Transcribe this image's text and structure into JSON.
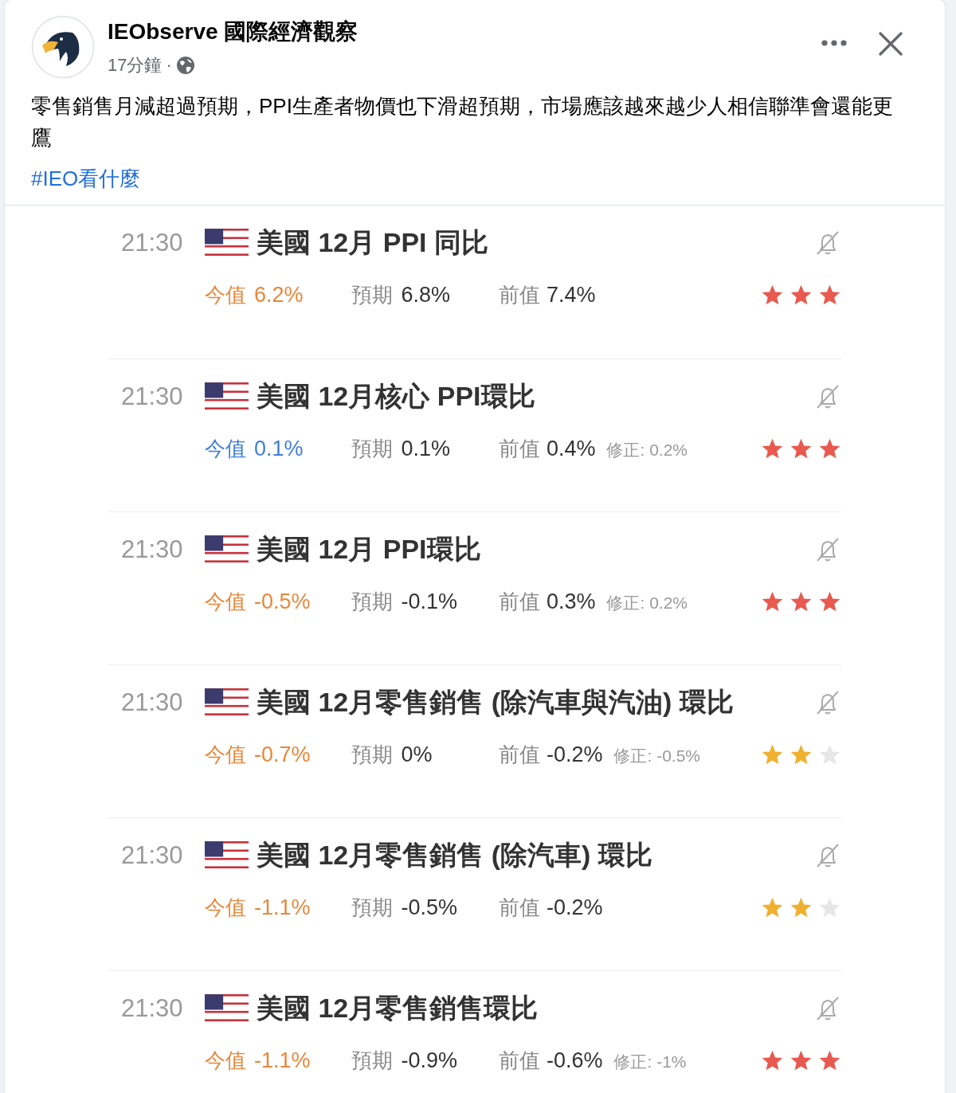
{
  "post": {
    "author": "IEObserve 國際經濟觀察",
    "time": "17分鐘",
    "separator": "·",
    "text": "零售銷售月減超過預期，PPI生產者物價也下滑超預期，市場應該越來越少人相信聯準會還能更鷹",
    "hashtag": "#IEO看什麼"
  },
  "events": [
    {
      "time": "21:30",
      "title": "美國 12月 PPI 同比",
      "actual": {
        "label": "今值",
        "value": "6.2%",
        "color": "#e8873a"
      },
      "forecast": {
        "label": "預期",
        "value": "6.8%"
      },
      "previous": {
        "label": "前值",
        "value": "7.4%"
      },
      "stars": 3
    },
    {
      "time": "21:30",
      "title": "美國 12月核心 PPI環比",
      "actual": {
        "label": "今值",
        "value": "0.1%",
        "color": "#3f7ed8"
      },
      "forecast": {
        "label": "預期",
        "value": "0.1%"
      },
      "previous": {
        "label": "前值",
        "value": "0.4%"
      },
      "revision": "修正: 0.2%",
      "stars": 3
    },
    {
      "time": "21:30",
      "title": "美國 12月 PPI環比",
      "actual": {
        "label": "今值",
        "value": "-0.5%",
        "color": "#e8873a"
      },
      "forecast": {
        "label": "預期",
        "value": "-0.1%"
      },
      "previous": {
        "label": "前值",
        "value": "0.3%"
      },
      "revision": "修正: 0.2%",
      "stars": 3
    },
    {
      "time": "21:30",
      "title": "美國 12月零售銷售 (除汽車與汽油) 環比",
      "actual": {
        "label": "今值",
        "value": "-0.7%",
        "color": "#e8873a"
      },
      "forecast": {
        "label": "預期",
        "value": "0%"
      },
      "previous": {
        "label": "前值",
        "value": "-0.2%"
      },
      "revision": "修正: -0.5%",
      "stars": 2
    },
    {
      "time": "21:30",
      "title": "美國 12月零售銷售 (除汽車) 環比",
      "actual": {
        "label": "今值",
        "value": "-1.1%",
        "color": "#e8873a"
      },
      "forecast": {
        "label": "預期",
        "value": "-0.5%"
      },
      "previous": {
        "label": "前值",
        "value": "-0.2%"
      },
      "stars": 2
    },
    {
      "time": "21:30",
      "title": "美國 12月零售銷售環比",
      "actual": {
        "label": "今值",
        "value": "-1.1%",
        "color": "#e8873a"
      },
      "forecast": {
        "label": "預期",
        "value": "-0.9%"
      },
      "previous": {
        "label": "前值",
        "value": "-0.6%"
      },
      "revision": "修正: -1%",
      "stars": 3
    }
  ]
}
